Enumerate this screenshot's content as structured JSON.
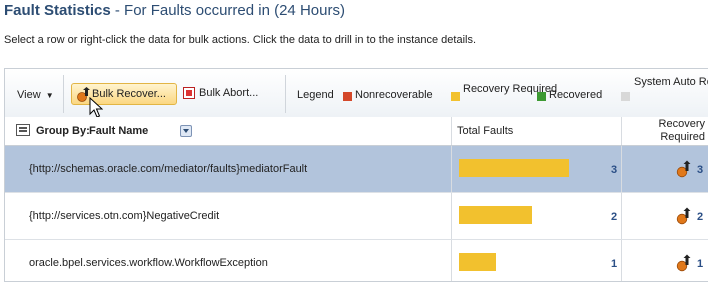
{
  "header": {
    "title": "Fault Statistics",
    "separator": " - ",
    "subtitle": "For Faults occurred in (24 Hours)",
    "instructions": "Select a row or right-click the data for bulk actions. Click the data to drill in to the instance details."
  },
  "toolbar": {
    "view_label": "View",
    "bulk_recover_label": "Bulk Recover...",
    "bulk_abort_label": "Bulk Abort..."
  },
  "legend": {
    "label": "Legend",
    "items": [
      {
        "label": "Nonrecoverable",
        "color": "#d4482a"
      },
      {
        "label": "Recovery Required",
        "color": "#f2c12e"
      },
      {
        "label": "Recovered",
        "color": "#3d9a33"
      },
      {
        "label": "System Auto Retries",
        "color": "#d8d8d8"
      }
    ]
  },
  "table": {
    "group_by_label": "Group By:",
    "fault_name_label": "Fault Name",
    "total_faults_label": "Total Faults",
    "recovery_required_label": "Recovery Required",
    "rows": [
      {
        "name": "{http://schemas.oracle.com/mediator/faults}mediatorFault",
        "total": "3",
        "recovery": "3",
        "fill": 1.0,
        "selected": true
      },
      {
        "name": "{http://services.otn.com}NegativeCredit",
        "total": "2",
        "recovery": "2",
        "fill": 0.667,
        "selected": false
      },
      {
        "name": "oracle.bpel.services.workflow.WorkflowException",
        "total": "1",
        "recovery": "1",
        "fill": 0.333,
        "selected": false
      }
    ]
  },
  "colors": {
    "accent": "#2d4d73",
    "selection": "#b2c4dc",
    "bar": "#f2c12e",
    "link": "#2b4f86"
  }
}
